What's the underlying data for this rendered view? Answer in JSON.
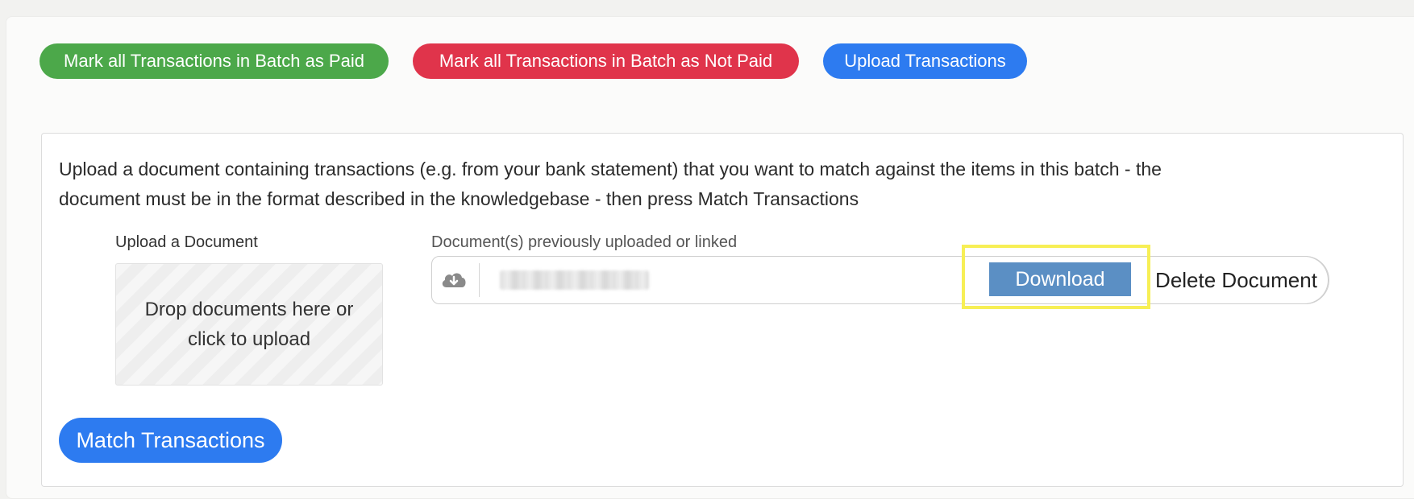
{
  "colors": {
    "paid": "#4ca84a",
    "not_paid": "#e0344b",
    "primary": "#2d7bf0",
    "download": "#5b8fc4",
    "highlight": "#f7ef55"
  },
  "actions": {
    "mark_paid": "Mark all Transactions in Batch as Paid",
    "mark_not_paid": "Mark all Transactions in Batch as Not Paid",
    "upload_transactions": "Upload Transactions"
  },
  "panel": {
    "description": "Upload a document containing transactions (e.g. from your bank statement) that you want to match against the items in this batch - the document must be in the format described in the knowledgebase - then press Match Transactions",
    "upload_label": "Upload a Document",
    "dropzone_text": "Drop documents here or click to upload",
    "previous_label": "Document(s) previously uploaded or linked",
    "download_label": "Download",
    "delete_label": "Delete Document",
    "match_label": "Match Transactions"
  },
  "icons": {
    "document": "cloud-download-icon"
  }
}
